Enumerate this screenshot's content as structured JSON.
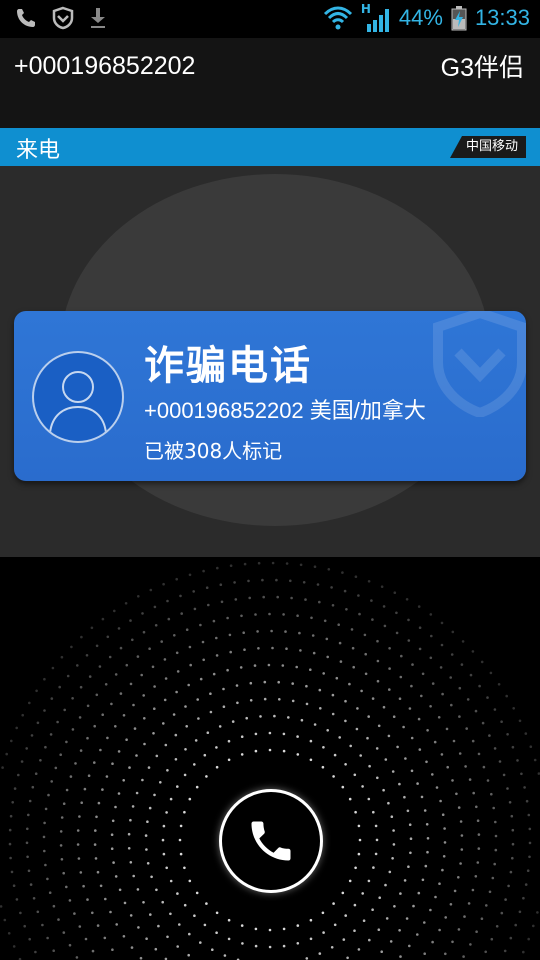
{
  "status_bar": {
    "battery": "44%",
    "time": "13:33",
    "network_type": "H",
    "icons": [
      "phone-icon",
      "shield-icon",
      "download-icon",
      "wifi-icon",
      "signal-icon",
      "battery-charging-icon"
    ]
  },
  "header": {
    "number": "+000196852202",
    "app_name": "G3伴侣"
  },
  "incoming": {
    "label": "来电",
    "carrier": "中国移动"
  },
  "card": {
    "title": "诈骗电话",
    "detail": "+000196852202 美国/加拿大",
    "marked": "已被308人标记"
  },
  "colors": {
    "accent": "#33b5e5",
    "incoming_bar": "#0f8fd0",
    "card": "#2f76d6"
  }
}
